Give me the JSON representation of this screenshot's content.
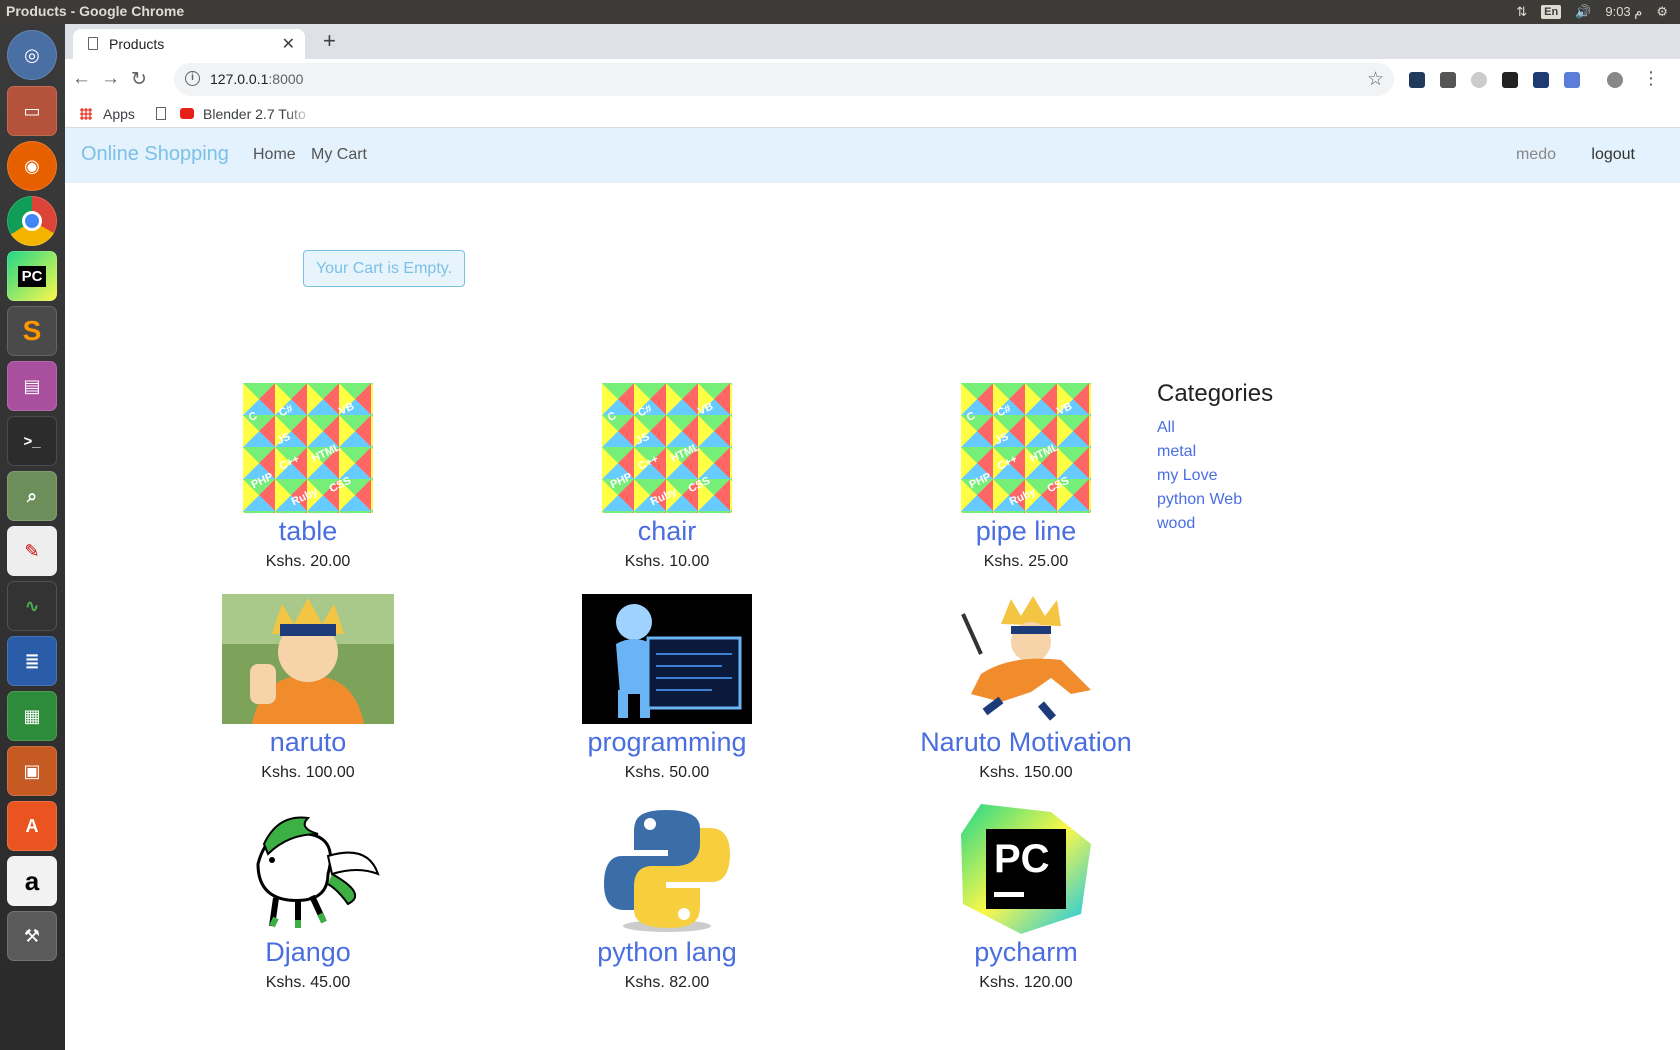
{
  "top_panel": {
    "window_title": "Products - Google Chrome",
    "keyboard_layout": "En",
    "clock": "9:03 م"
  },
  "browser": {
    "tab_title": "Products",
    "url_host": "127.0.0.1",
    "url_port": ":8000",
    "bookmarks": {
      "apps": "Apps",
      "blender": "Blender 2.7 Tuto"
    }
  },
  "navbar": {
    "brand": "Online Shopping",
    "home": "Home",
    "my_cart": "My Cart",
    "user": "medo",
    "logout": "logout"
  },
  "cart_message": "Your Cart is Empty.",
  "products": [
    {
      "name": "table",
      "price": "Kshs. 20.00",
      "image": "code-tiles"
    },
    {
      "name": "chair",
      "price": "Kshs. 10.00",
      "image": "code-tiles"
    },
    {
      "name": "pipe line",
      "price": "Kshs. 25.00",
      "image": "code-tiles"
    },
    {
      "name": "naruto",
      "price": "Kshs. 100.00",
      "image": "naruto-thumbs-up"
    },
    {
      "name": "programming",
      "price": "Kshs. 50.00",
      "image": "hologram-figure"
    },
    {
      "name": "Naruto Motivation",
      "price": "Kshs. 150.00",
      "image": "naruto-running"
    },
    {
      "name": "Django",
      "price": "Kshs. 45.00",
      "image": "django-pony"
    },
    {
      "name": "python lang",
      "price": "Kshs. 82.00",
      "image": "python-logo"
    },
    {
      "name": "pycharm",
      "price": "Kshs. 120.00",
      "image": "pycharm-logo"
    }
  ],
  "tile_words": [
    "C",
    "C#",
    "JS",
    "VB",
    "C++",
    "HTML",
    "PHP",
    "Ruby",
    "CSS"
  ],
  "pycharm_logo_text": "PC",
  "categories": {
    "heading": "Categories",
    "items": [
      "All",
      "metal",
      "my Love",
      "python Web",
      "wood"
    ]
  }
}
